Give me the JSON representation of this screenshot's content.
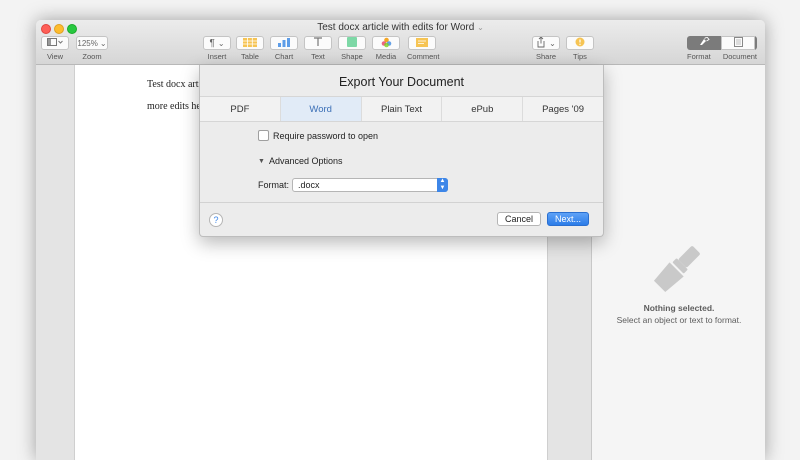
{
  "window": {
    "title": "Test docx article with edits for Word",
    "title_chevron": "⌄"
  },
  "toolbar": {
    "view_label": "View",
    "zoom_value": "125%",
    "zoom_label": "Zoom",
    "insert_label": "Insert",
    "table_label": "Table",
    "chart_label": "Chart",
    "text_label": "Text",
    "shape_label": "Shape",
    "media_label": "Media",
    "comment_label": "Comment",
    "share_label": "Share",
    "tips_label": "Tips",
    "format_label": "Format",
    "document_label": "Document"
  },
  "document": {
    "line1": "Test docx arti",
    "line2": "more edits he"
  },
  "inspector": {
    "title": "Nothing selected.",
    "subtitle": "Select an object or text to format."
  },
  "export_dialog": {
    "title": "Export Your Document",
    "tabs": [
      {
        "label": "PDF",
        "active": false
      },
      {
        "label": "Word",
        "active": true
      },
      {
        "label": "Plain Text",
        "active": false
      },
      {
        "label": "ePub",
        "active": false
      },
      {
        "label": "Pages '09",
        "active": false
      }
    ],
    "require_password_label": "Require password to open",
    "require_password_checked": false,
    "advanced_label": "Advanced Options",
    "format_label": "Format:",
    "format_value": ".docx",
    "help_label": "?",
    "cancel_label": "Cancel",
    "next_label": "Next..."
  },
  "colors": {
    "accent": "#2c7ce8",
    "active_tab_bg": "#e1ebf7",
    "active_tab_text": "#3b6fb6"
  }
}
